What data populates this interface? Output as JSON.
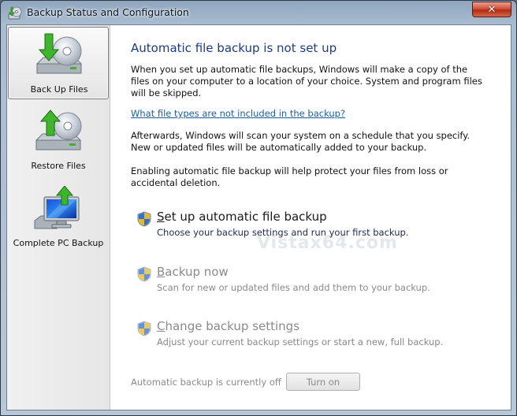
{
  "window": {
    "title": "Backup Status and Configuration",
    "close_label": "✕"
  },
  "sidebar": {
    "items": [
      {
        "label": "Back Up Files",
        "icon": "backup-files-icon",
        "selected": true
      },
      {
        "label": "Restore Files",
        "icon": "restore-files-icon",
        "selected": false
      },
      {
        "label": "Complete PC Backup",
        "icon": "complete-pc-backup-icon",
        "selected": false
      }
    ]
  },
  "main": {
    "heading": "Automatic file backup is not set up",
    "intro": "When you set up automatic file backups, Windows will make a copy of the files on your computer to a location of your choice. System and program files will be skipped.",
    "link": "What file types are not included in the backup?",
    "afterwards": "Afterwards, Windows will scan your system on a schedule that you specify. New or updated files will be automatically added to your backup.",
    "enabling": "Enabling automatic file backup will help protect your files from loss or accidental deletion.",
    "tasks": [
      {
        "title_accel": "S",
        "title_rest": "et up automatic file backup",
        "desc": "Choose your backup settings and run your first backup.",
        "enabled": true
      },
      {
        "title_accel": "B",
        "title_rest": "ackup now",
        "desc": "Scan for new or updated files and add them to your backup.",
        "enabled": false
      },
      {
        "title_accel": "C",
        "title_rest": "hange backup settings",
        "desc": "Adjust your current backup settings or start a new, full backup.",
        "enabled": false
      }
    ],
    "status": "Automatic backup is currently off",
    "turn_on_label": "Turn on",
    "watermark": "Vistax64.com"
  },
  "colors": {
    "heading": "#1e3a8a",
    "link": "#1a5ea8",
    "disabled_text": "#8a8a8a"
  }
}
